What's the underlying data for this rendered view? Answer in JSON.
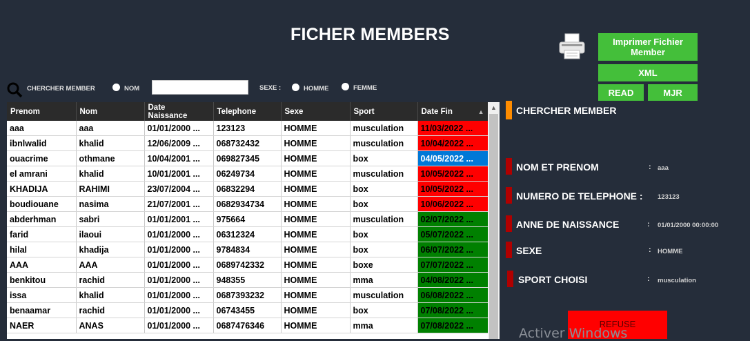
{
  "title": "FICHER MEMBERS",
  "icons": {
    "printer": "printer-icon",
    "search": "search-icon"
  },
  "buttons": {
    "print": "Imprimer Fichier Member",
    "xml": "XML",
    "read": "READ",
    "mjr": "MJR"
  },
  "search": {
    "label": "CHERCHER MEMBER",
    "nom_option": "NOM",
    "value": "",
    "sexe_label": "SEXE :",
    "homme_option": "HOMME",
    "femme_option": "FEMME"
  },
  "table": {
    "headers": [
      "Prenom",
      "Nom",
      "Date Naissance",
      "Telephone",
      "Sexe",
      "Sport",
      "Date Fin"
    ],
    "rows": [
      {
        "prenom": "aaa",
        "nom": "aaa",
        "naissance": "01/01/2000 ...",
        "tel": "123123",
        "sexe": "HOMME",
        "sport": "musculation",
        "fin": "11/03/2022 ...",
        "status": "expired"
      },
      {
        "prenom": "ibnlwalid",
        "nom": "khalid",
        "naissance": "12/06/2009 ...",
        "tel": "068732432",
        "sexe": "HOMME",
        "sport": "musculation",
        "fin": "10/04/2022 ...",
        "status": "expired"
      },
      {
        "prenom": "ouacrime",
        "nom": "othmane",
        "naissance": "10/04/2001 ...",
        "tel": "069827345",
        "sexe": "HOMME",
        "sport": "box",
        "fin": "04/05/2022 ...",
        "status": "selected"
      },
      {
        "prenom": "el amrani",
        "nom": "khalid",
        "naissance": "10/01/2001 ...",
        "tel": "06249734",
        "sexe": "HOMME",
        "sport": "musculation",
        "fin": "10/05/2022 ...",
        "status": "expired"
      },
      {
        "prenom": "KHADIJA",
        "nom": "RAHIMI",
        "naissance": "23/07/2004 ...",
        "tel": "06832294",
        "sexe": "HOMME",
        "sport": "box",
        "fin": "10/05/2022 ...",
        "status": "expired"
      },
      {
        "prenom": "boudiouane",
        "nom": "nasima",
        "naissance": "21/07/2001 ...",
        "tel": "0682934734",
        "sexe": "HOMME",
        "sport": "box",
        "fin": "10/06/2022 ...",
        "status": "expired"
      },
      {
        "prenom": "abderhman",
        "nom": "sabri",
        "naissance": "01/01/2001 ...",
        "tel": "975664",
        "sexe": "HOMME",
        "sport": "musculation",
        "fin": "02/07/2022 ...",
        "status": "active"
      },
      {
        "prenom": "farid",
        "nom": "ilaoui",
        "naissance": "01/01/2000 ...",
        "tel": "06312324",
        "sexe": "HOMME",
        "sport": "box",
        "fin": "05/07/2022 ...",
        "status": "active"
      },
      {
        "prenom": "hilal",
        "nom": "khadija",
        "naissance": "01/01/2000 ...",
        "tel": "9784834",
        "sexe": "HOMME",
        "sport": "box",
        "fin": "06/07/2022 ...",
        "status": "active"
      },
      {
        "prenom": "AAA",
        "nom": "AAA",
        "naissance": "01/01/2000 ...",
        "tel": "0689742332",
        "sexe": "HOMME",
        "sport": "boxe",
        "fin": "07/07/2022 ...",
        "status": "active"
      },
      {
        "prenom": "benkitou",
        "nom": "rachid",
        "naissance": "01/01/2000 ...",
        "tel": "948355",
        "sexe": "HOMME",
        "sport": "mma",
        "fin": "04/08/2022 ...",
        "status": "active"
      },
      {
        "prenom": "issa",
        "nom": "khalid",
        "naissance": "01/01/2000 ...",
        "tel": "0687393232",
        "sexe": "HOMME",
        "sport": "musculation",
        "fin": "06/08/2022 ...",
        "status": "active"
      },
      {
        "prenom": "benaamar",
        "nom": "rachid",
        "naissance": "01/01/2000 ...",
        "tel": "06743455",
        "sexe": "HOMME",
        "sport": "box",
        "fin": "07/08/2022 ...",
        "status": "active"
      },
      {
        "prenom": "NAER",
        "nom": "ANAS",
        "naissance": "01/01/2000 ...",
        "tel": "0687476346",
        "sexe": "HOMME",
        "sport": "mma",
        "fin": "07/08/2022 ...",
        "status": "active"
      }
    ],
    "status_colors": {
      "expired": "#ff0000",
      "active": "#008000",
      "selected": "#0078d7"
    }
  },
  "details": {
    "header": "CHERCHER MEMBER",
    "fields": [
      {
        "label": "NOM ET PRENOM",
        "colon": ":",
        "value": "aaa"
      },
      {
        "label": "NUMERO DE TELEPHONE :",
        "colon": "",
        "value": "123123"
      },
      {
        "label": "ANNE DE NAISSANCE",
        "colon": ":",
        "value": "01/01/2000 00:00:00"
      },
      {
        "label": "SEXE",
        "colon": ":",
        "value": "HOMME"
      },
      {
        "label": "SPORT CHOISI",
        "colon": ":",
        "value": "musculation"
      }
    ],
    "refuse_label": "REFUSE"
  },
  "colors": {
    "background": "#252d3a",
    "button_green": "#44bf3a",
    "accent_orange": "#ff8c00",
    "accent_red": "#b00000",
    "refuse_red": "#ff0000"
  },
  "watermark": "Activer Windows"
}
